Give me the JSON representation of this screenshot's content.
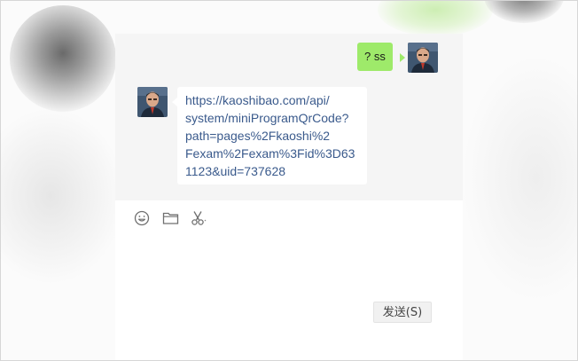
{
  "chat": {
    "messages": [
      {
        "sender": "self",
        "text": "? ss"
      },
      {
        "sender": "other",
        "text": "https://kaoshibao.com/api/\nsystem/miniProgramQrCode?\npath=pages%2Fkaoshi%2\nFexam%2Fexam%3Fid%3D63\n1123&uid=737628"
      }
    ]
  },
  "toolbar": {
    "icons": [
      "emoji-icon",
      "folder-icon",
      "screenshot-scissors-icon"
    ]
  },
  "input": {
    "value": "",
    "send_label": "发送(S)"
  },
  "colors": {
    "self_bubble": "#9eea6a",
    "other_bubble": "#ffffff",
    "link_text": "#3a5a8c",
    "chat_background": "#f5f5f5"
  }
}
